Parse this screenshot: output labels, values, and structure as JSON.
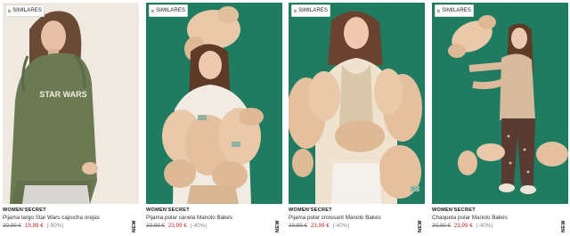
{
  "colors": {
    "sale_price": "#c0282f",
    "teal_background": "#1f7c61",
    "beige_background": "#efe9e2",
    "fleece_cream": "#e9c9a9"
  },
  "similar_icon": "similar-items-icon",
  "products": [
    {
      "badge": "SIMILARES",
      "tag": "NEW",
      "brand": "WOMEN'SECRET",
      "name": "Pijama largo Star Wars capucha orejas",
      "old_price": "39,99 €",
      "new_price": "19,99 €",
      "discount": "(-50%)",
      "print": "STAR WARS"
    },
    {
      "badge": "SIMILARES",
      "tag": "NEW",
      "brand": "WOMEN'SECRET",
      "name": "Pijama polar canela Manolo Bakes",
      "old_price": "39,99 €",
      "new_price": "23,99 €",
      "discount": "(-40%)"
    },
    {
      "badge": "SIMILARES",
      "tag": "NEW",
      "brand": "WOMEN'SECRET",
      "name": "Pijama polar croissant Manolo Bakes",
      "old_price": "39,99 €",
      "new_price": "23,99 €",
      "discount": "(-40%)"
    },
    {
      "badge": "SIMILARES",
      "tag": "NEW",
      "brand": "WOMEN'SECRET",
      "name": "Chaqueta polar Manolo Bakes",
      "old_price": "39,99 €",
      "new_price": "23,99 €",
      "discount": "(-40%)"
    }
  ]
}
